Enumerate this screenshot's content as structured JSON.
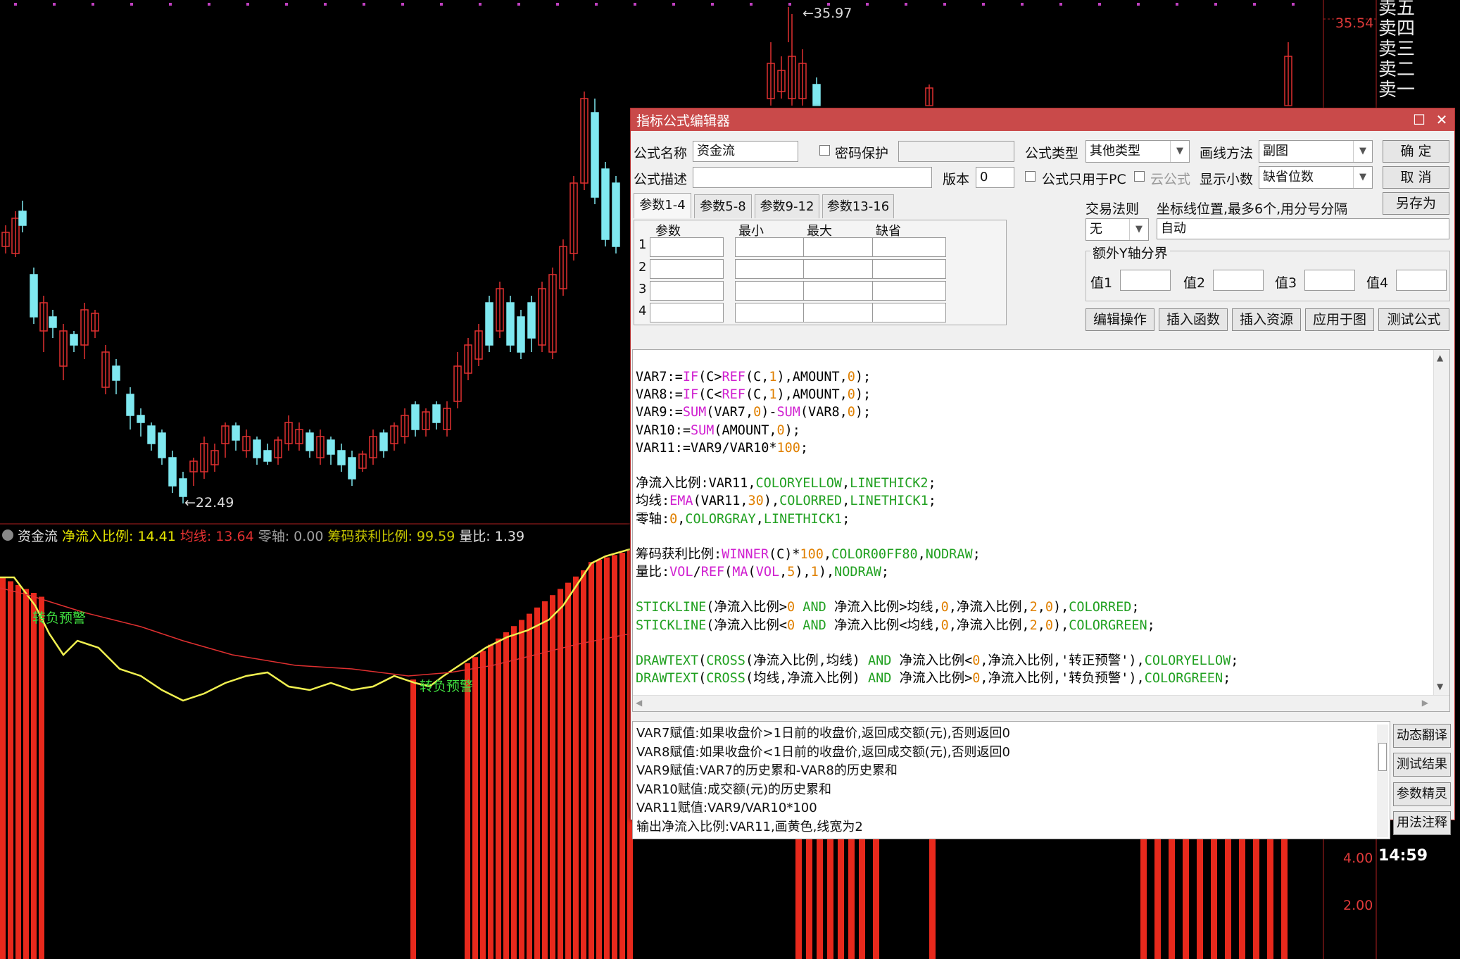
{
  "chart": {
    "price_high_label": "35.97",
    "price_low_label": "22.49",
    "top_price_axis": "35.54",
    "axis_4": "4.00",
    "axis_2": "2.00",
    "time": "14:59",
    "order_book": [
      "卖五",
      "卖四",
      "卖三",
      "卖二",
      "卖一"
    ],
    "annotation_1": "转负预警",
    "annotation_2": "转负预警"
  },
  "indicator_header": {
    "name": "资金流",
    "items": [
      {
        "label": "净流入比例: 14.41",
        "color": "#e6e600"
      },
      {
        "label": "均线: 13.64",
        "color": "#e03030"
      },
      {
        "label": "零轴: 0.00",
        "color": "#a0a0a0"
      },
      {
        "label": "筹码获利比例: 99.59",
        "color": "#c8c800"
      },
      {
        "label": "量比: 1.39",
        "color": "#e0e0e0"
      }
    ]
  },
  "dialog": {
    "title": "指标公式编辑器",
    "name_label": "公式名称",
    "name_value": "资金流",
    "password_label": "密码保护",
    "type_label": "公式类型",
    "type_value": "其他类型",
    "draw_label": "画线方法",
    "draw_value": "副图",
    "ok": "确  定",
    "cancel": "取  消",
    "save_as": "另存为",
    "desc_label": "公式描述",
    "version_label": "版本",
    "version_value": "0",
    "pc_only_label": "公式只用于PC",
    "cloud_label": "云公式",
    "decimals_label": "显示小数",
    "decimals_value": "缺省位数",
    "tabs": [
      "参数1-4",
      "参数5-8",
      "参数9-12",
      "参数13-16"
    ],
    "param_headers": [
      "参数",
      "最小",
      "最大",
      "缺省"
    ],
    "row_numbers": [
      "1",
      "2",
      "3",
      "4"
    ],
    "trade_rule_label": "交易法则",
    "trade_rule_value": "无",
    "axis_pos_label": "坐标线位置,最多6个,用分号分隔",
    "axis_pos_value": "自动",
    "extra_y_label": "额外Y轴分界",
    "val_labels": [
      "值1",
      "值2",
      "值3",
      "值4"
    ],
    "buttons": [
      "编辑操作",
      "插入函数",
      "插入资源",
      "应用于图",
      "测试公式"
    ],
    "code_lines": [
      [
        [
          "VAR7:=",
          "#000"
        ],
        [
          "IF",
          "#d020d0"
        ],
        [
          "(C>",
          "#000"
        ],
        [
          "REF",
          "#d020d0"
        ],
        [
          "(C,",
          "#000"
        ],
        [
          "1",
          "#e08000"
        ],
        [
          "),AMOUNT,",
          "#000"
        ],
        [
          "0",
          "#e08000"
        ],
        [
          ");",
          "#000"
        ]
      ],
      [
        [
          "VAR8:=",
          "#000"
        ],
        [
          "IF",
          "#d020d0"
        ],
        [
          "(C<",
          "#000"
        ],
        [
          "REF",
          "#d020d0"
        ],
        [
          "(C,",
          "#000"
        ],
        [
          "1",
          "#e08000"
        ],
        [
          "),AMOUNT,",
          "#000"
        ],
        [
          "0",
          "#e08000"
        ],
        [
          ");",
          "#000"
        ]
      ],
      [
        [
          "VAR9:=",
          "#000"
        ],
        [
          "SUM",
          "#d020d0"
        ],
        [
          "(VAR7,",
          "#000"
        ],
        [
          "0",
          "#e08000"
        ],
        [
          ")-",
          "#000"
        ],
        [
          "SUM",
          "#d020d0"
        ],
        [
          "(VAR8,",
          "#000"
        ],
        [
          "0",
          "#e08000"
        ],
        [
          ");",
          "#000"
        ]
      ],
      [
        [
          "VAR10:=",
          "#000"
        ],
        [
          "SUM",
          "#d020d0"
        ],
        [
          "(AMOUNT,",
          "#000"
        ],
        [
          "0",
          "#e08000"
        ],
        [
          ");",
          "#000"
        ]
      ],
      [
        [
          "VAR11:=VAR9/VAR10*",
          "#000"
        ],
        [
          "100",
          "#e08000"
        ],
        [
          ";",
          "#000"
        ]
      ],
      [],
      [
        [
          "净流入比例:VAR11,",
          "#000"
        ],
        [
          "COLORYELLOW",
          "#20a020"
        ],
        [
          ",",
          "#000"
        ],
        [
          "LINETHICK2",
          "#20a020"
        ],
        [
          ";",
          "#000"
        ]
      ],
      [
        [
          "均线:",
          "#000"
        ],
        [
          "EMA",
          "#d020d0"
        ],
        [
          "(VAR11,",
          "#000"
        ],
        [
          "30",
          "#e08000"
        ],
        [
          "),",
          "#000"
        ],
        [
          "COLORRED",
          "#20a020"
        ],
        [
          ",",
          "#000"
        ],
        [
          "LINETHICK1",
          "#20a020"
        ],
        [
          ";",
          "#000"
        ]
      ],
      [
        [
          "零轴:",
          "#000"
        ],
        [
          "0",
          "#e08000"
        ],
        [
          ",",
          "#000"
        ],
        [
          "COLORGRAY",
          "#20a020"
        ],
        [
          ",",
          "#000"
        ],
        [
          "LINETHICK1",
          "#20a020"
        ],
        [
          ";",
          "#000"
        ]
      ],
      [],
      [
        [
          "筹码获利比例:",
          "#000"
        ],
        [
          "WINNER",
          "#d020d0"
        ],
        [
          "(C)*",
          "#000"
        ],
        [
          "100",
          "#e08000"
        ],
        [
          ",",
          "#000"
        ],
        [
          "COLOR00FF80",
          "#20a020"
        ],
        [
          ",",
          "#000"
        ],
        [
          "NODRAW",
          "#20a020"
        ],
        [
          ";",
          "#000"
        ]
      ],
      [
        [
          "量比:",
          "#000"
        ],
        [
          "VOL",
          "#d020d0"
        ],
        [
          "/",
          "#000"
        ],
        [
          "REF",
          "#d020d0"
        ],
        [
          "(",
          "#000"
        ],
        [
          "MA",
          "#d020d0"
        ],
        [
          "(",
          "#000"
        ],
        [
          "VOL",
          "#d020d0"
        ],
        [
          ",",
          "#000"
        ],
        [
          "5",
          "#e08000"
        ],
        [
          "),",
          "#000"
        ],
        [
          "1",
          "#e08000"
        ],
        [
          "),",
          "#000"
        ],
        [
          "NODRAW",
          "#20a020"
        ],
        [
          ";",
          "#000"
        ]
      ],
      [],
      [
        [
          "STICKLINE",
          "#20a020"
        ],
        [
          "(净流入比例>",
          "#000"
        ],
        [
          "0",
          "#e08000"
        ],
        [
          " AND ",
          "#20a020"
        ],
        [
          "净流入比例>均线,",
          "#000"
        ],
        [
          "0",
          "#e08000"
        ],
        [
          ",净流入比例,",
          "#000"
        ],
        [
          "2",
          "#e08000"
        ],
        [
          ",",
          "#000"
        ],
        [
          "0",
          "#e08000"
        ],
        [
          "),",
          "#000"
        ],
        [
          "COLORRED",
          "#20a020"
        ],
        [
          ";",
          "#000"
        ]
      ],
      [
        [
          "STICKLINE",
          "#20a020"
        ],
        [
          "(净流入比例<",
          "#000"
        ],
        [
          "0",
          "#e08000"
        ],
        [
          " AND ",
          "#20a020"
        ],
        [
          "净流入比例<均线,",
          "#000"
        ],
        [
          "0",
          "#e08000"
        ],
        [
          ",净流入比例,",
          "#000"
        ],
        [
          "2",
          "#e08000"
        ],
        [
          ",",
          "#000"
        ],
        [
          "0",
          "#e08000"
        ],
        [
          "),",
          "#000"
        ],
        [
          "COLORGREEN",
          "#20a020"
        ],
        [
          ";",
          "#000"
        ]
      ],
      [],
      [
        [
          "DRAWTEXT",
          "#20a020"
        ],
        [
          "(",
          "#000"
        ],
        [
          "CROSS",
          "#20a020"
        ],
        [
          "(净流入比例,均线) ",
          "#000"
        ],
        [
          "AND",
          "#20a020"
        ],
        [
          " 净流入比例<",
          "#000"
        ],
        [
          "0",
          "#e08000"
        ],
        [
          ",净流入比例,'转正预警'),",
          "#000"
        ],
        [
          "COLORYELLOW",
          "#20a020"
        ],
        [
          ";",
          "#000"
        ]
      ],
      [
        [
          "DRAWTEXT",
          "#20a020"
        ],
        [
          "(",
          "#000"
        ],
        [
          "CROSS",
          "#20a020"
        ],
        [
          "(均线,净流入比例) ",
          "#000"
        ],
        [
          "AND",
          "#20a020"
        ],
        [
          " 净流入比例>",
          "#000"
        ],
        [
          "0",
          "#e08000"
        ],
        [
          ",净流入比例,'转负预警'),",
          "#000"
        ],
        [
          "COLORGREEN",
          "#20a020"
        ],
        [
          ";",
          "#000"
        ]
      ]
    ],
    "descriptions": [
      "VAR7赋值:如果收盘价>1日前的收盘价,返回成交额(元),否则返回0",
      "VAR8赋值:如果收盘价<1日前的收盘价,返回成交额(元),否则返回0",
      "VAR9赋值:VAR7的历史累和-VAR8的历史累和",
      "VAR10赋值:成交额(元)的历史累和",
      "VAR11赋值:VAR9/VAR10*100",
      "输出净流入比例:VAR11,画黄色,线宽为2"
    ],
    "side_buttons": [
      "动态翻译",
      "测试结果",
      "参数精灵",
      "用法注释"
    ]
  }
}
